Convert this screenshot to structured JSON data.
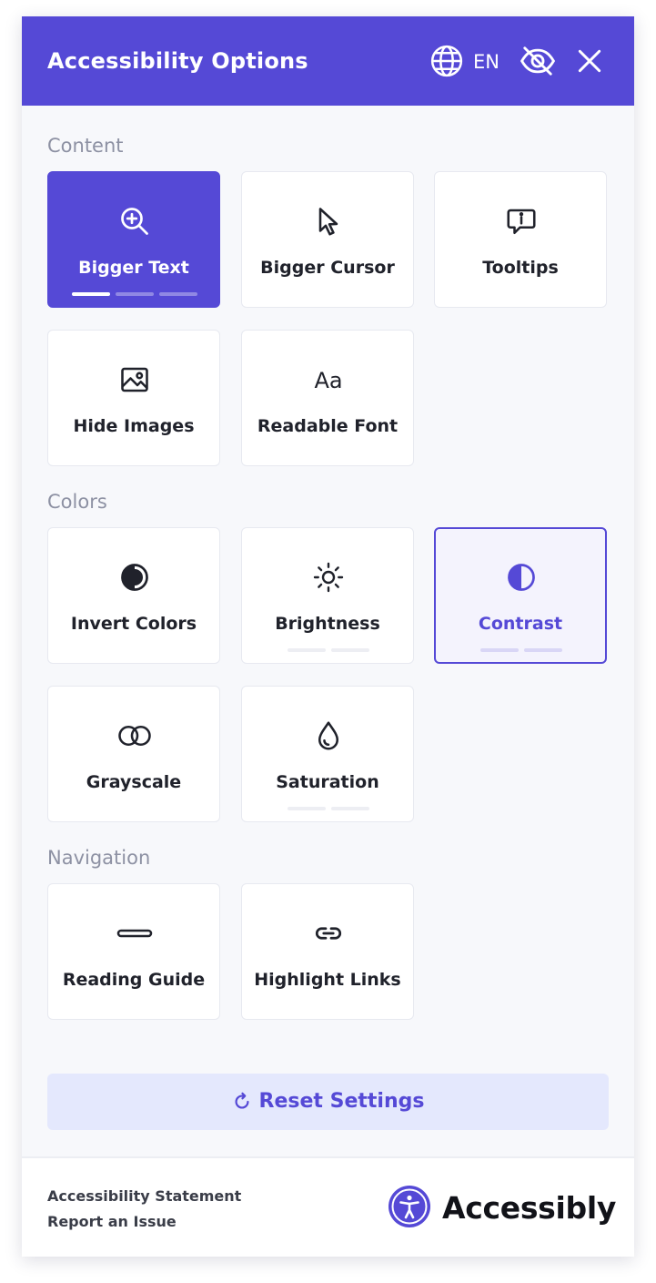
{
  "header": {
    "title": "Accessibility Options",
    "language": "EN",
    "icons": [
      "globe-icon",
      "eye-slash-icon",
      "close-icon"
    ]
  },
  "sections": [
    {
      "label": "Content",
      "items": [
        {
          "label": "Bigger Text",
          "icon": "zoom-in-icon",
          "state": "active",
          "levels": 3,
          "level": 1
        },
        {
          "label": "Bigger Cursor",
          "icon": "cursor-icon"
        },
        {
          "label": "Tooltips",
          "icon": "tooltip-icon"
        },
        {
          "label": "Hide Images",
          "icon": "image-icon"
        },
        {
          "label": "Readable Font",
          "icon": "font-icon"
        }
      ]
    },
    {
      "label": "Colors",
      "items": [
        {
          "label": "Invert Colors",
          "icon": "invert-icon"
        },
        {
          "label": "Brightness",
          "icon": "sun-icon",
          "levels": 2,
          "level": 0
        },
        {
          "label": "Contrast",
          "icon": "contrast-icon",
          "state": "selected",
          "levels": 2,
          "level": 0
        },
        {
          "label": "Grayscale",
          "icon": "grayscale-icon"
        },
        {
          "label": "Saturation",
          "icon": "droplet-icon",
          "levels": 2,
          "level": 0
        }
      ]
    },
    {
      "label": "Navigation",
      "items": [
        {
          "label": "Reading Guide",
          "icon": "reading-guide-icon"
        },
        {
          "label": "Highlight Links",
          "icon": "link-icon"
        }
      ]
    }
  ],
  "reset": {
    "label": "Reset Settings",
    "icon": "reset-icon"
  },
  "footer": {
    "links": [
      "Accessibility Statement",
      "Report an Issue"
    ],
    "brand": "Accessibly",
    "brand_icon": "accessibility-person-icon"
  },
  "colors": {
    "accent": "#5549d6",
    "panel_bg": "#f7f8fb",
    "reset_bg": "#e4e8fd",
    "text": "#20222b",
    "muted": "#8d91a3"
  }
}
